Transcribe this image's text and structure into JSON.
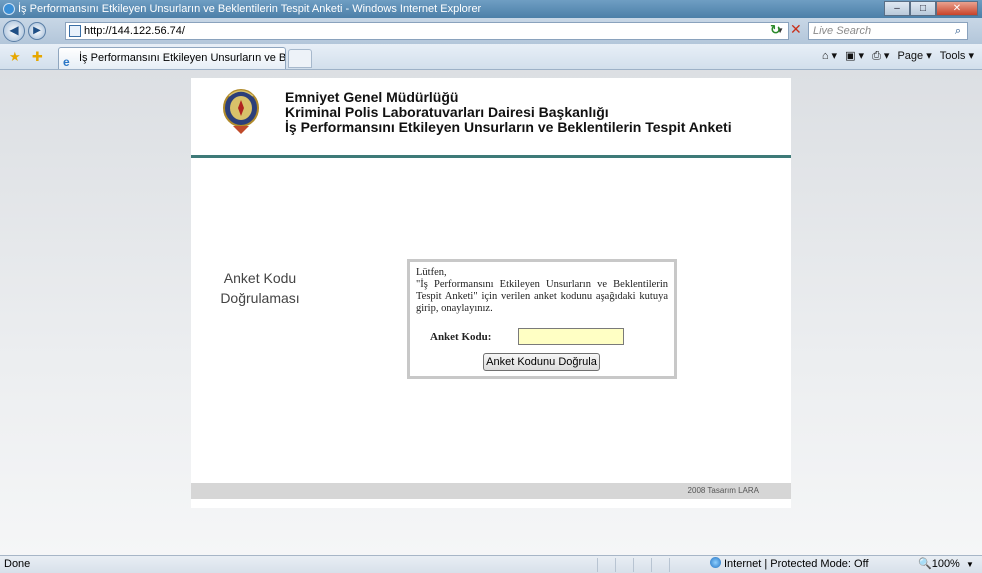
{
  "window": {
    "title": "İş Performansını Etkileyen Unsurların ve Beklentilerin Tespit Anketi - Windows Internet Explorer",
    "minimize": "–",
    "maximize": "□",
    "close": "✕"
  },
  "address": {
    "url": "http://144.122.56.74/",
    "search_placeholder": "Live Search"
  },
  "tab": {
    "label": "İş Performansını Etkileyen Unsurların ve Beklentil..."
  },
  "commands": {
    "page": "Page ▾",
    "tools": "Tools ▾"
  },
  "header": {
    "line1": "Emniyet Genel Müdürlüğü",
    "line2": "Kriminal Polis Laboratuvarları Dairesi Başkanlığı",
    "line3": "İş Performansını Etkileyen Unsurların ve Beklentilerin Tespit Anketi"
  },
  "side_label": {
    "line1": "Anket Kodu",
    "line2": "Doğrulaması"
  },
  "form": {
    "greeting": "Lütfen,",
    "instructions": "\"İş Performansını Etkileyen Unsurların ve Beklentilerin Tespit Anketi\" için verilen anket kodunu aşağıdaki kutuya girip, onaylayınız.",
    "code_label": "Anket Kodu:",
    "code_value": "",
    "button_label": "Anket Kodunu Doğrula"
  },
  "footer": {
    "text": "2008   Tasarım LARA"
  },
  "status": {
    "left": "Done",
    "zone": "Internet | Protected Mode: Off",
    "zoom": "100%"
  }
}
